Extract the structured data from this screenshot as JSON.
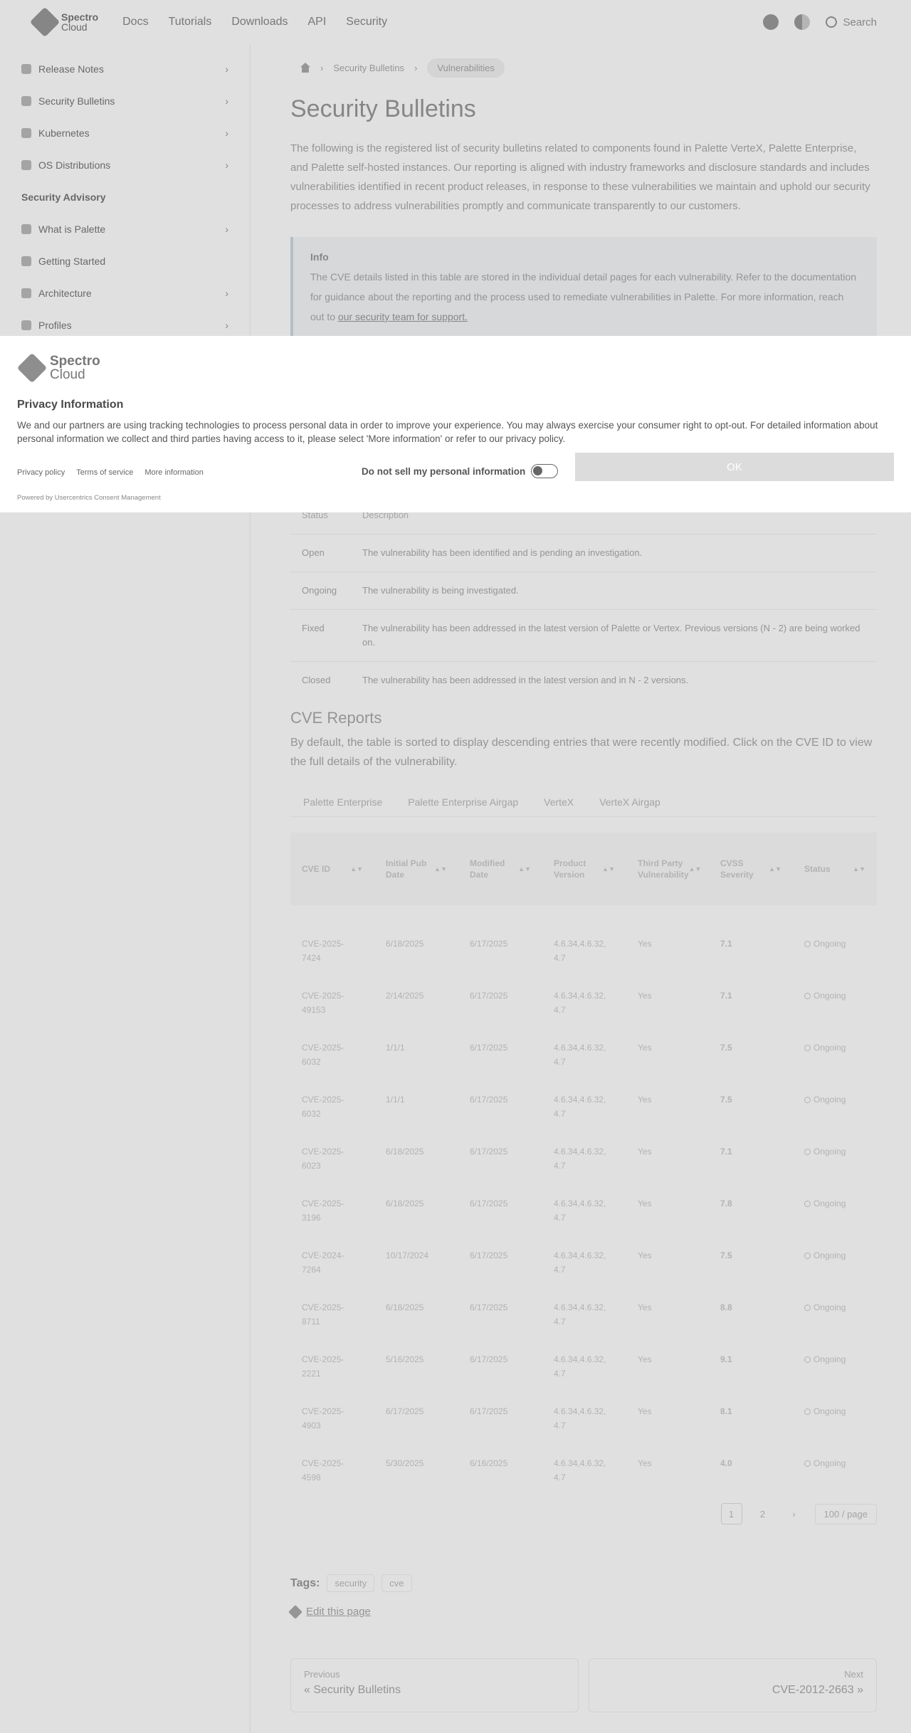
{
  "navbar": {
    "logo_line1": "Spectro",
    "logo_line2": "Cloud",
    "links": [
      "Docs",
      "Tutorials",
      "Downloads",
      "API",
      "Security"
    ],
    "search_label": "Search"
  },
  "sidebar": {
    "items": [
      {
        "label": "Release Notes",
        "icon": "notes-icon"
      },
      {
        "label": "Security Bulletins",
        "icon": "shield-icon"
      },
      {
        "label": "Kubernetes",
        "icon": "cube-icon"
      },
      {
        "label": "OS Distributions",
        "icon": "os-icon"
      },
      {
        "label": "Security Advisory",
        "icon": ""
      },
      {
        "label": "What is Palette",
        "icon": "info-icon"
      },
      {
        "label": "Getting Started",
        "icon": "rocket-icon"
      },
      {
        "label": "Architecture",
        "icon": "arch-icon"
      },
      {
        "label": "Profiles",
        "icon": "layers-icon"
      }
    ]
  },
  "breadcrumb": {
    "items": [
      "Security Bulletins",
      "Vulnerabilities"
    ]
  },
  "page": {
    "title": "Security Bulletins",
    "intro": "The following is the registered list of security bulletins related to components found in Palette VerteX, Palette Enterprise, and Palette self-hosted instances. Our reporting is aligned with industry frameworks and disclosure standards and includes vulnerabilities identified in recent product releases, in response to these vulnerabilities we maintain and uphold our security processes to address vulnerabilities promptly and communicate transparently to our customers.",
    "info_title": "Info",
    "info_body": "The CVE details listed in this table are stored in the individual detail pages for each vulnerability. Refer to the documentation for guidance about the reporting and the process used to remediate vulnerabilities in Palette. For more information, reach out to",
    "info_link": "our security team for support."
  },
  "status_table": {
    "headers": [
      "Status",
      "Description"
    ],
    "rows": [
      {
        "status": "Open",
        "desc": "The vulnerability has been identified and is pending an investigation."
      },
      {
        "status": "Ongoing",
        "desc": "The vulnerability is being investigated."
      },
      {
        "status": "Fixed",
        "desc": "The vulnerability has been addressed in the latest version of Palette or Vertex. Previous versions (N - 2) are being worked on."
      },
      {
        "status": "Closed",
        "desc": "The vulnerability has been addressed in the latest version and in N - 2 versions."
      }
    ]
  },
  "cve_section": {
    "title": "CVE Reports",
    "lead": "By default, the table is sorted to display descending entries that were recently modified. Click on the CVE ID to view the full details of the vulnerability.",
    "tabs": [
      "Palette Enterprise",
      "Palette Enterprise Airgap",
      "VerteX",
      "VerteX Airgap"
    ],
    "headers": [
      "CVE ID",
      "Initial Pub Date",
      "Modified Date",
      "Product Version",
      "Third Party Vulnerability",
      "CVSS Severity",
      "Status"
    ],
    "rows": [
      {
        "id": "CVE-2025-\n7424",
        "pub": "6/18/2025",
        "mod": "6/17/2025",
        "ver": "4.6.34,4.6.32,\n4.7",
        "third": "Yes",
        "cvss": "7.1",
        "status": "Ongoing"
      },
      {
        "id": "CVE-2025-\n49153",
        "pub": "2/14/2025",
        "mod": "6/17/2025",
        "ver": "4.6.34,4.6.32,\n4.7",
        "third": "Yes",
        "cvss": "7.1",
        "status": "Ongoing"
      },
      {
        "id": "CVE-2025-\n6032",
        "pub": "1/1/1",
        "mod": "6/17/2025",
        "ver": "4.6.34,4.6.32,\n4.7",
        "third": "Yes",
        "cvss": "7.5",
        "status": "Ongoing"
      },
      {
        "id": "CVE-2025-\n6032",
        "pub": "1/1/1",
        "mod": "6/17/2025",
        "ver": "4.6.34,4.6.32,\n4.7",
        "third": "Yes",
        "cvss": "7.5",
        "status": "Ongoing"
      },
      {
        "id": "CVE-2025-\n6023",
        "pub": "6/18/2025",
        "mod": "6/17/2025",
        "ver": "4.6.34,4.6.32,\n4.7",
        "third": "Yes",
        "cvss": "7.1",
        "status": "Ongoing"
      },
      {
        "id": "CVE-2025-\n3196",
        "pub": "6/18/2025",
        "mod": "6/17/2025",
        "ver": "4.6.34,4.6.32,\n4.7",
        "third": "Yes",
        "cvss": "7.8",
        "status": "Ongoing"
      },
      {
        "id": "CVE-2024-\n7264",
        "pub": "10/17/2024",
        "mod": "6/17/2025",
        "ver": "4.6.34,4.6.32,\n4.7",
        "third": "Yes",
        "cvss": "7.5",
        "status": "Ongoing"
      },
      {
        "id": "CVE-2025-\n8711",
        "pub": "6/18/2025",
        "mod": "6/17/2025",
        "ver": "4.6.34,4.6.32,\n4.7",
        "third": "Yes",
        "cvss": "8.8",
        "status": "Ongoing"
      },
      {
        "id": "CVE-2025-\n2221",
        "pub": "5/16/2025",
        "mod": "6/17/2025",
        "ver": "4.6.34,4.6.32,\n4.7",
        "third": "Yes",
        "cvss": "9.1",
        "status": "Ongoing"
      },
      {
        "id": "CVE-2025-\n4903",
        "pub": "6/17/2025",
        "mod": "6/17/2025",
        "ver": "4.6.34,4.6.32,\n4.7",
        "third": "Yes",
        "cvss": "8.1",
        "status": "Ongoing"
      },
      {
        "id": "CVE-2025-\n4598",
        "pub": "5/30/2025",
        "mod": "6/16/2025",
        "ver": "4.6.34,4.6.32,\n4.7",
        "third": "Yes",
        "cvss": "4.0",
        "status": "Ongoing"
      }
    ]
  },
  "pager": {
    "pages": [
      "1",
      "2"
    ],
    "next": "›",
    "page_size": "100 / page"
  },
  "tags": {
    "label": "Tags:",
    "items": [
      "security",
      "cve"
    ]
  },
  "edit_link": "Edit this page",
  "prevnext": {
    "prev_sub": "Previous",
    "prev_title": "« Security Bulletins",
    "next_sub": "Next",
    "next_title": "CVE-2012-2663 »"
  },
  "consent": {
    "logo_line1": "Spectro",
    "logo_line2": "Cloud",
    "title": "Privacy Information",
    "body": "We and our partners are using tracking technologies to process personal data in order to improve your experience. You may always exercise your consumer right to opt-out. For detailed information about personal information we collect and third parties having access to it, please select 'More information' or refer to our privacy policy.",
    "links": [
      "Privacy policy",
      "Terms of service",
      "More information"
    ],
    "powered": "Powered by Usercentrics Consent Management",
    "toggle_label": "Do not sell my personal information",
    "ok_label": "OK"
  },
  "colors": {
    "accent_red": "#e23b1c",
    "ok_button": "#dcdcdc"
  }
}
